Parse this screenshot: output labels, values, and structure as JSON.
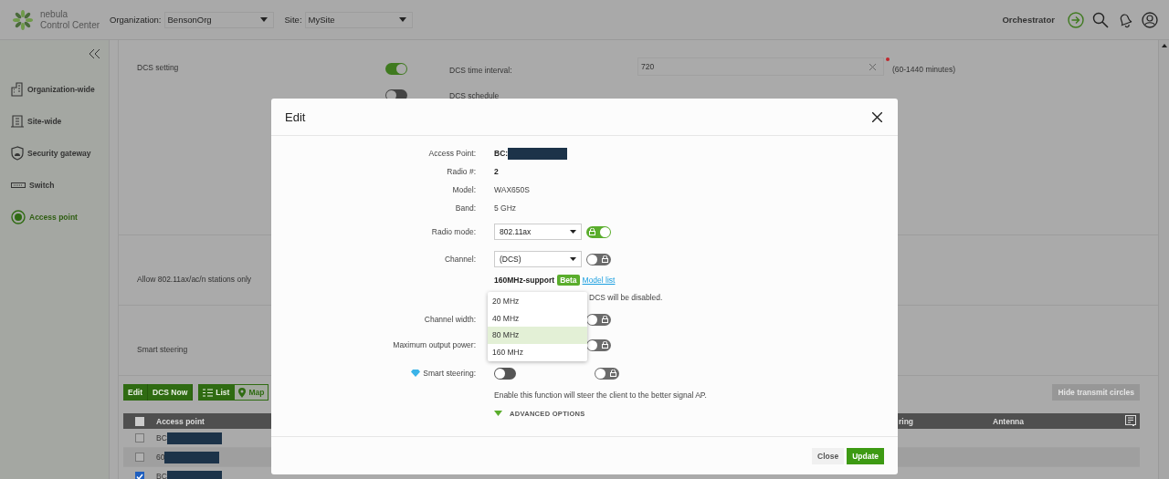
{
  "header": {
    "logo_line1": "nebula",
    "logo_line2": "Control Center",
    "org_label": "Organization:",
    "org_value": "BensonOrg",
    "site_label": "Site:",
    "site_value": "MySite",
    "orchestrator": "Orchestrator"
  },
  "sidebar": {
    "items": [
      {
        "label": "Organization-wide",
        "selected": false
      },
      {
        "label": "Site-wide",
        "selected": false
      },
      {
        "label": "Security gateway",
        "selected": false
      },
      {
        "label": "Switch",
        "selected": false
      },
      {
        "label": "Access point",
        "selected": true
      }
    ]
  },
  "dcs": {
    "label": "DCS setting",
    "enabled": true,
    "interval_label": "DCS time interval:",
    "interval_value": "720",
    "required": true,
    "hint": "(60-1440 minutes)",
    "schedule_label": "DCS schedule",
    "schedule_enabled": false
  },
  "sections": [
    {
      "label": "Allow 802.11ax/ac/n stations only"
    },
    {
      "label": "Smart steering"
    }
  ],
  "toolbar": {
    "actions": [
      "Edit",
      "DCS Now"
    ],
    "views": [
      {
        "label": "List",
        "selected": true
      },
      {
        "label": "Map",
        "selected": false
      }
    ],
    "hide_button": {
      "label": "Hide transmit circles",
      "disabled": true
    }
  },
  "table": {
    "columns": [
      "Access point",
      "ring",
      "Antenna"
    ],
    "all_checked": false,
    "rows": [
      {
        "checked": false,
        "access_point": "BC",
        "redacted": true
      },
      {
        "checked": false,
        "access_point": "60",
        "redacted": true
      },
      {
        "checked": true,
        "access_point": "BC",
        "redacted": true
      }
    ]
  },
  "modal": {
    "title": "Edit",
    "fields": [
      {
        "kind": "text",
        "label": "Access Point:",
        "value": "BC:",
        "bold": true,
        "redacted": true
      },
      {
        "kind": "text",
        "label": "Radio #:",
        "value": "2",
        "bold": true,
        "redacted": false
      },
      {
        "kind": "text",
        "label": "Model:",
        "value": "WAX650S",
        "bold": false,
        "redacted": false
      },
      {
        "kind": "text",
        "label": "Band:",
        "value": "5 GHz",
        "bold": false,
        "redacted": false
      },
      {
        "kind": "select",
        "label": "Radio mode:",
        "value": "802.11ax",
        "override_on": true
      },
      {
        "kind": "select",
        "label": "Channel:",
        "value": "(DCS)",
        "override_on": false
      },
      {
        "kind": "support",
        "text": "160MHz-support",
        "badge": "Beta",
        "link": "Model list"
      },
      {
        "kind": "covered_note",
        "text": "DCS will be disabled."
      },
      {
        "kind": "hidden_select",
        "label": "Channel width:",
        "override_on": false
      },
      {
        "kind": "hidden_select",
        "label": "Maximum output power:",
        "override_on": false
      },
      {
        "kind": "toggle",
        "label": "Smart steering:",
        "premium": true,
        "on": false,
        "override_on": false
      },
      {
        "kind": "note",
        "text": "Enable this function will steer the client to the better signal AP."
      },
      {
        "kind": "expander",
        "text": "ADVANCED OPTIONS",
        "expanded": false
      }
    ],
    "dropdown": [
      {
        "label": "20 MHz",
        "selected": false
      },
      {
        "label": "40 MHz",
        "selected": false
      },
      {
        "label": "80 MHz",
        "selected": true
      },
      {
        "label": "160 MHz",
        "selected": false
      }
    ],
    "buttons": [
      {
        "label": "Close",
        "kind": "secondary"
      },
      {
        "label": "Update",
        "kind": "primary"
      }
    ]
  }
}
